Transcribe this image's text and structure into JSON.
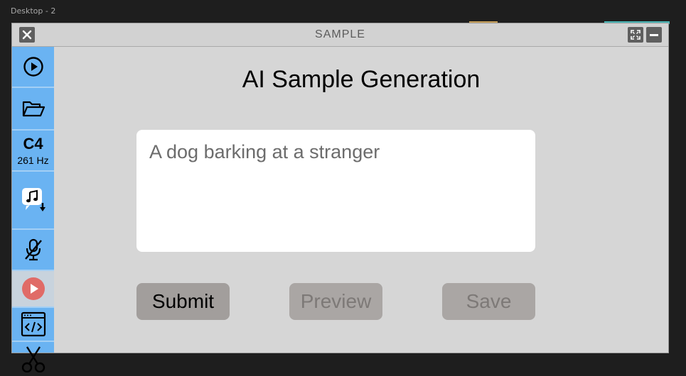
{
  "canvas": {
    "frame_label": "Desktop - 2"
  },
  "window": {
    "title": "SAMPLE",
    "close_icon": "close-icon",
    "fullscreen_icon": "fullscreen-icon",
    "minimize_icon": "minimize-icon"
  },
  "sidebar": {
    "items": [
      {
        "name": "play",
        "icon": "play-circle-icon"
      },
      {
        "name": "open-folder",
        "icon": "folder-open-icon"
      },
      {
        "name": "note",
        "note": "C4",
        "frequency": "261 Hz"
      },
      {
        "name": "download-music",
        "icon": "music-download-icon"
      },
      {
        "name": "mic-off",
        "icon": "mic-off-icon"
      },
      {
        "name": "record",
        "icon": "record-play-icon",
        "state": "disabled"
      },
      {
        "name": "code",
        "icon": "code-window-icon"
      },
      {
        "name": "cut",
        "icon": "scissors-icon"
      }
    ]
  },
  "main": {
    "heading": "AI Sample Generation",
    "prompt_text": "A dog barking at a stranger",
    "buttons": {
      "submit": "Submit",
      "preview": "Preview",
      "save": "Save"
    }
  },
  "colors": {
    "background": "#1e1e1e",
    "window": "#d6d6d6",
    "sidebar": "#6ab3f2",
    "button_primary": "#a29e9c",
    "record_red": "#e06b67"
  }
}
